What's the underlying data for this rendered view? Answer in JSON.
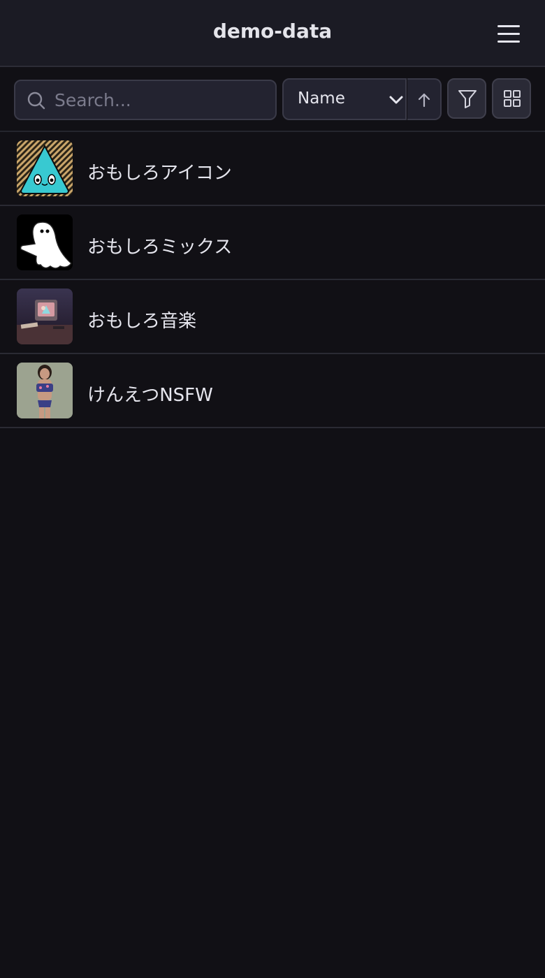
{
  "header": {
    "title": "demo-data",
    "menu_icon": "hamburger-menu-icon"
  },
  "toolbar": {
    "search_placeholder": "Search...",
    "search_value": "",
    "sort_label": "Name",
    "sort_direction": "ascending",
    "icons": [
      "search-icon",
      "chevron-down-icon",
      "arrow-up-icon",
      "filter-icon",
      "grid-view-icon"
    ]
  },
  "items": [
    {
      "name": "おもしろアイコン",
      "thumb": "cyan-triangle-face"
    },
    {
      "name": "おもしろミックス",
      "thumb": "white-ghost"
    },
    {
      "name": "おもしろ音楽",
      "thumb": "retro-tv-desk"
    },
    {
      "name": "けんえつNSFW",
      "thumb": "person-photo"
    }
  ],
  "colors": {
    "background": "#111015",
    "header": "#1b1b24",
    "control_bg": "#232330",
    "border": "#3a3a48",
    "text": "#e6e6ee"
  }
}
